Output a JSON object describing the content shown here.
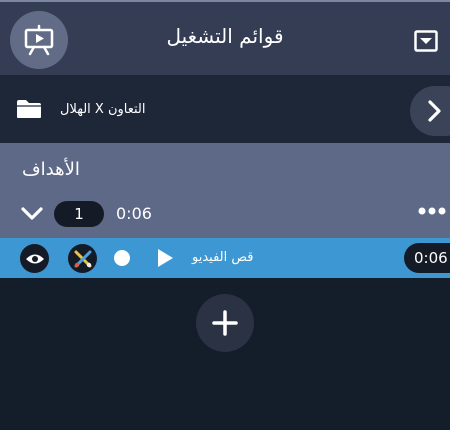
{
  "header": {
    "title": "قوائم التشغيل",
    "present_icon": "presentation-board-icon",
    "collapse_icon": "collapse-square-icon"
  },
  "match": {
    "title": "الهلال X التعاون",
    "folder_icon": "folder-icon",
    "next_icon": "chevron-right-icon"
  },
  "playlist": {
    "title": "الأهداف",
    "count": "1",
    "duration": "0:06",
    "more_icon": "more-dots-icon",
    "expand_icon": "chevron-down-icon"
  },
  "clips": [
    {
      "label": "قص الفيديو",
      "duration": "0:06",
      "icons": [
        "eye-icon",
        "tools-icon",
        "record-dot-icon",
        "play-icon"
      ]
    }
  ],
  "add_icon": "plus-icon",
  "colors": {
    "background": "#141d2a",
    "header": "#353d55",
    "section": "#5d6987",
    "clip_highlight": "#3d97d3",
    "badge": "#141b26"
  }
}
